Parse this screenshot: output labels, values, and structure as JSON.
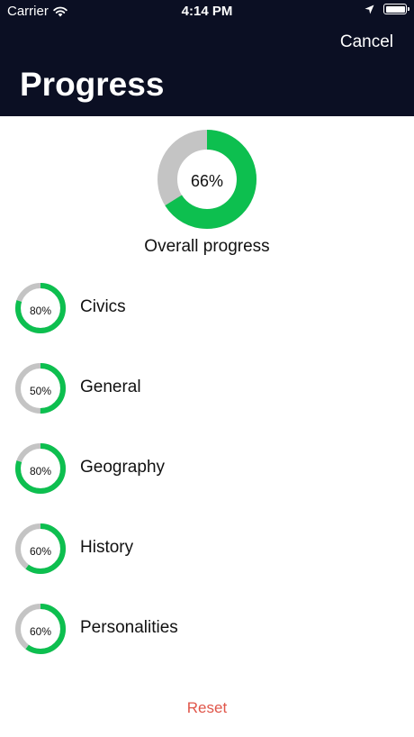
{
  "status_bar": {
    "carrier": "Carrier",
    "time": "4:14 PM",
    "icons": [
      "wifi-icon",
      "location-arrow-icon",
      "battery-icon"
    ]
  },
  "header": {
    "cancel_label": "Cancel",
    "title": "Progress"
  },
  "overall": {
    "percent_label": "66%",
    "fraction": 0.66,
    "caption": "Overall progress"
  },
  "subjects": [
    {
      "name": "Civics",
      "percent_label": "80%",
      "fraction": 0.8
    },
    {
      "name": "General",
      "percent_label": "50%",
      "fraction": 0.5
    },
    {
      "name": "Geography",
      "percent_label": "80%",
      "fraction": 0.8
    },
    {
      "name": "History",
      "percent_label": "60%",
      "fraction": 0.6
    },
    {
      "name": "Personalities",
      "percent_label": "60%",
      "fraction": 0.6
    }
  ],
  "reset_label": "Reset",
  "colors": {
    "header_bg": "#0b0f23",
    "progress": "#0dbf4f",
    "track": "#c4c4c4",
    "reset": "#e0564a"
  }
}
